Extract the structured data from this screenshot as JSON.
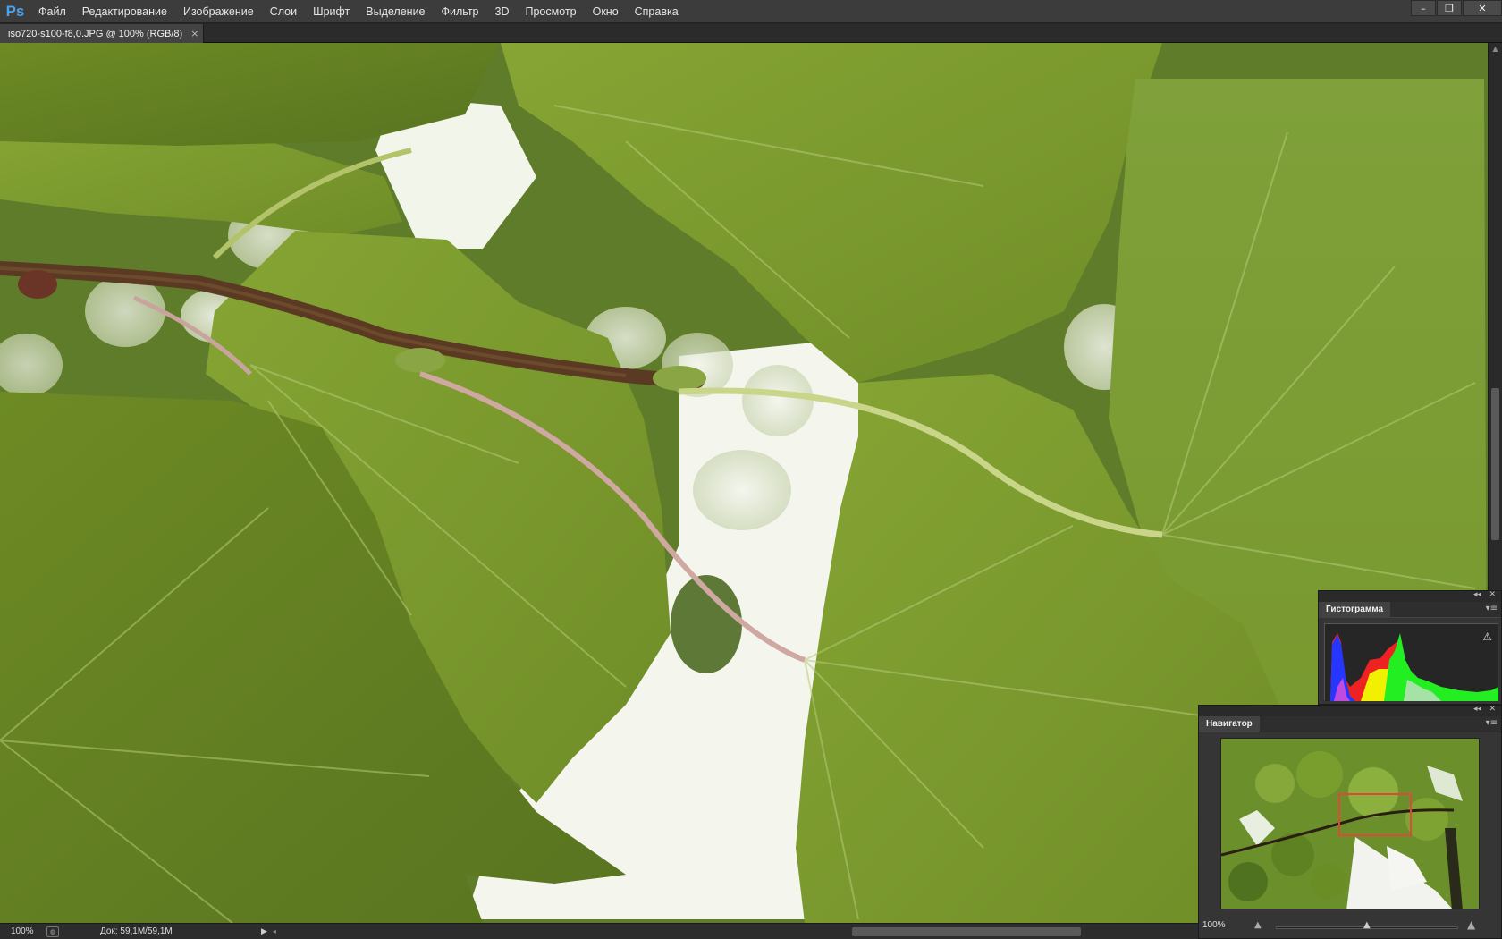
{
  "app": {
    "logo": "Ps",
    "menu": [
      "Файл",
      "Редактирование",
      "Изображение",
      "Слои",
      "Шрифт",
      "Выделение",
      "Фильтр",
      "3D",
      "Просмотр",
      "Окно",
      "Справка"
    ],
    "window_controls": {
      "minimize": "–",
      "restore": "❐",
      "close": "✕"
    }
  },
  "document": {
    "tab_label": "iso720-s100-f8,0.JPG @ 100% (RGB/8)",
    "tab_close": "×"
  },
  "status": {
    "zoom": "100%",
    "doc_info": "Док: 59,1M/59,1M"
  },
  "histogram_panel": {
    "title": "Гистограмма",
    "warning_icon": "warning-triangle-icon"
  },
  "navigator_panel": {
    "title": "Навигатор",
    "zoom": "100%"
  },
  "colors": {
    "menubar_bg": "#3c3c3c",
    "panel_bg": "#353535",
    "ps_blue": "#4aa3f0",
    "leaf_green": "#76952a",
    "nav_frame": "#e0483a"
  }
}
